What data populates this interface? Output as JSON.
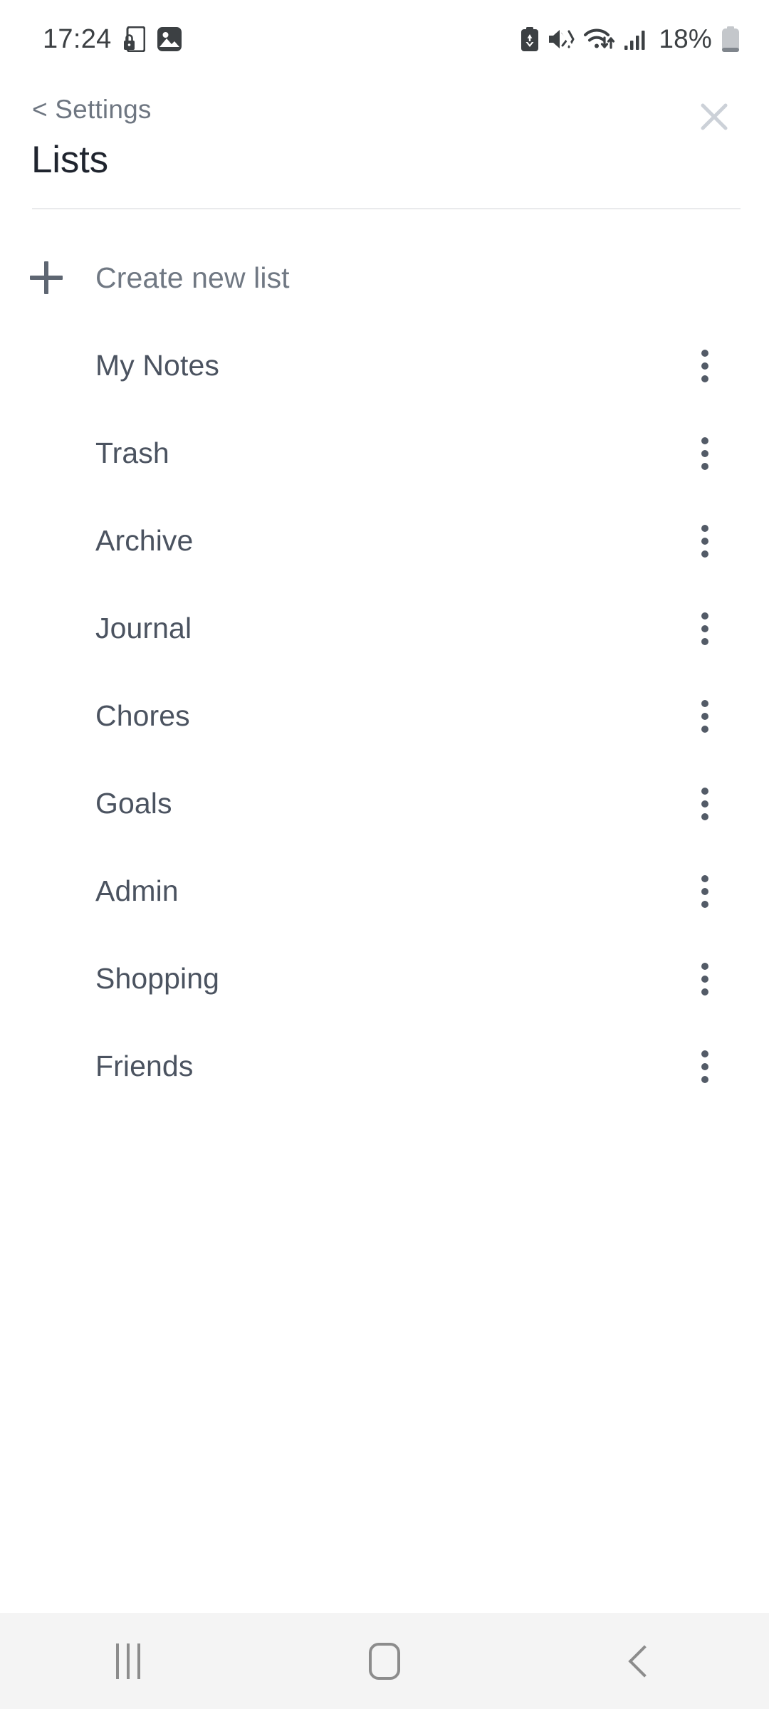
{
  "status_bar": {
    "time": "17:24",
    "battery_percent": "18%",
    "left_icons": [
      "phone-lock-icon",
      "gallery-image-icon"
    ],
    "right_icons": [
      "power-saving-icon",
      "mute-vibrate-icon",
      "wifi-data-icon",
      "signal-bars-icon",
      "battery-icon"
    ]
  },
  "header": {
    "breadcrumb": "< Settings",
    "title": "Lists",
    "close_icon": "close-icon"
  },
  "create": {
    "label": "Create new list",
    "icon": "plus-icon"
  },
  "lists": {
    "items": [
      {
        "label": "My Notes",
        "menu_icon": "kebab-menu-icon"
      },
      {
        "label": "Trash",
        "menu_icon": "kebab-menu-icon"
      },
      {
        "label": "Archive",
        "menu_icon": "kebab-menu-icon"
      },
      {
        "label": "Journal",
        "menu_icon": "kebab-menu-icon"
      },
      {
        "label": "Chores",
        "menu_icon": "kebab-menu-icon"
      },
      {
        "label": "Goals",
        "menu_icon": "kebab-menu-icon"
      },
      {
        "label": "Admin",
        "menu_icon": "kebab-menu-icon"
      },
      {
        "label": "Shopping",
        "menu_icon": "kebab-menu-icon"
      },
      {
        "label": "Friends",
        "menu_icon": "kebab-menu-icon"
      }
    ]
  },
  "nav_bar": {
    "recents_icon": "recents-icon",
    "home_icon": "home-icon",
    "back_icon": "back-icon"
  },
  "colors": {
    "background": "#ffffff",
    "title": "#1f242e",
    "breadcrumb": "#6e7681",
    "list_label": "#4b5360",
    "create_label": "#707883",
    "divider": "#e9eaec",
    "close": "#ccd1d8",
    "nav_bar_bg": "#f4f4f4",
    "nav_icon": "#8c8c8c"
  }
}
